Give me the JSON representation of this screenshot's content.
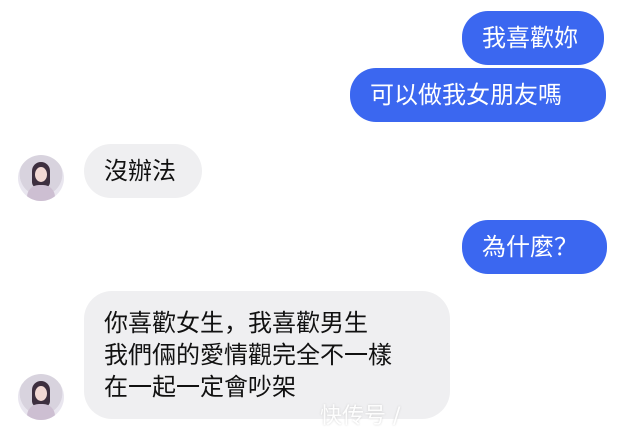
{
  "messages": {
    "m1": "我喜歡妳",
    "m2": "可以做我女朋友嗎",
    "m3": "沒辦法",
    "m4": "為什麼？",
    "m5": {
      "line1": "你喜歡女生，我喜歡男生",
      "line2": "我們倆的愛情觀完全不一樣",
      "line3": "在一起一定會吵架"
    }
  },
  "watermark": "快传号 /",
  "colors": {
    "outgoing_bubble": "#3b67f0",
    "incoming_bubble": "#efeff1"
  }
}
